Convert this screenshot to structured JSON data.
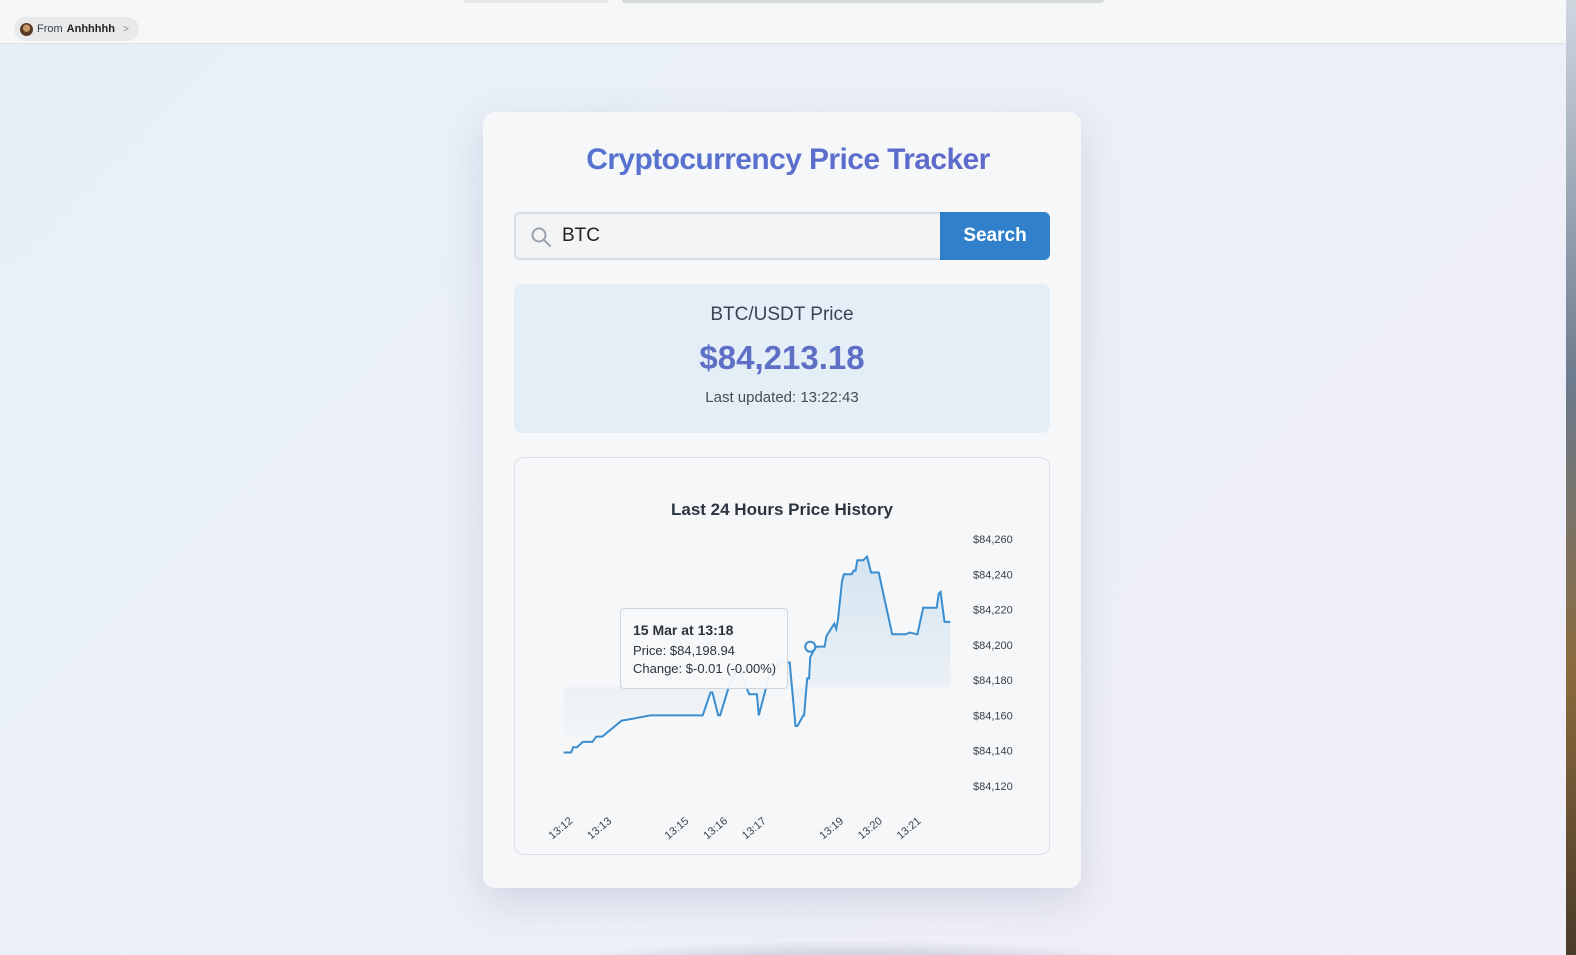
{
  "browser": {
    "from_prefix": "From",
    "from_user": "Anhhhhh",
    "chevron": ">"
  },
  "app": {
    "title": "Cryptocurrency Price Tracker"
  },
  "search": {
    "value": "BTC",
    "button_label": "Search",
    "icon": "search-icon"
  },
  "price_panel": {
    "pair_label": "BTC/USDT Price",
    "price": "$84,213.18",
    "last_updated": "Last updated: 13:22:43"
  },
  "tooltip": {
    "date": "15 Mar at 13:18",
    "price": "Price: $84,198.94",
    "change": "Change: $-0.01 (-0.00%)"
  },
  "colors": {
    "accent": "#3180cc",
    "title_gradient_start": "#4a7fd4",
    "title_gradient_end": "#6a5fc7",
    "price_color": "#5f6fc6",
    "line_color": "#3a8ed0"
  },
  "chart_data": {
    "type": "area",
    "title": "Last 24 Hours Price History",
    "xlabel": "",
    "ylabel": "",
    "y_axis_position": "right",
    "grid": false,
    "ylim": [
      84120,
      84260
    ],
    "y_ticks": [
      84260,
      84240,
      84220,
      84200,
      84180,
      84160,
      84140,
      84120
    ],
    "y_tick_labels": [
      "$84,260",
      "$84,240",
      "$84,220",
      "$84,200",
      "$84,180",
      "$84,160",
      "$84,140",
      "$84,120"
    ],
    "x_tick_labels": [
      "13:12",
      "13:13",
      "13:15",
      "13:16",
      "13:17",
      "13:19",
      "13:20",
      "13:21"
    ],
    "x_tick_minutes": [
      12,
      13,
      15,
      16,
      17,
      19,
      20,
      21
    ],
    "xlim_minutes": [
      11.6,
      22.2
    ],
    "series": [
      {
        "x_minutes": [
          12.0,
          12.2,
          12.25,
          12.35,
          12.5,
          12.75,
          12.85,
          13.0,
          13.5,
          13.75,
          14.25,
          14.5,
          14.8,
          14.82,
          15.05,
          15.1,
          15.3,
          15.35,
          15.55,
          15.6,
          15.8,
          15.85,
          16.0,
          16.05,
          16.3,
          16.5,
          16.55,
          16.8,
          17.0,
          17.05,
          17.35,
          17.6,
          17.85,
          18.0,
          18.05,
          18.2,
          18.22,
          18.3,
          18.35,
          18.38,
          18.5,
          18.55,
          18.75,
          18.8,
          19.0,
          19.05,
          19.1,
          19.2,
          19.25,
          19.45,
          19.5,
          19.55,
          19.6,
          19.75,
          19.85,
          19.95,
          20.0,
          20.05,
          20.15,
          20.5,
          20.6,
          20.8,
          20.85,
          20.95,
          21.15,
          21.3,
          21.45,
          21.5,
          21.55,
          21.65,
          21.7,
          21.75,
          21.85,
          22.0
        ],
        "y": [
          84139,
          84139,
          84142,
          84142,
          84145,
          84145,
          84148,
          84148,
          84157,
          84158,
          84160,
          84160,
          84160,
          84160,
          84160,
          84160,
          84160,
          84160,
          84160,
          84160,
          84173,
          84173,
          84160,
          84160,
          84178,
          84186,
          84186,
          84172,
          84172,
          84160,
          84185,
          84190,
          84190,
          84154,
          84154,
          84160,
          84160,
          84181,
          84181,
          84193,
          84198,
          84199,
          84199,
          84205,
          84212,
          84209,
          84215,
          84236,
          84240,
          84240,
          84242,
          84242,
          84248,
          84248,
          84250,
          84241,
          84241,
          84241,
          84241,
          84206,
          84206,
          84206,
          84206,
          84207,
          84206,
          84221,
          84221,
          84221,
          84221,
          84221,
          84229,
          84230,
          84213,
          84213
        ]
      }
    ],
    "highlight": {
      "x_minute": 18.38,
      "y": 84198.94
    }
  }
}
